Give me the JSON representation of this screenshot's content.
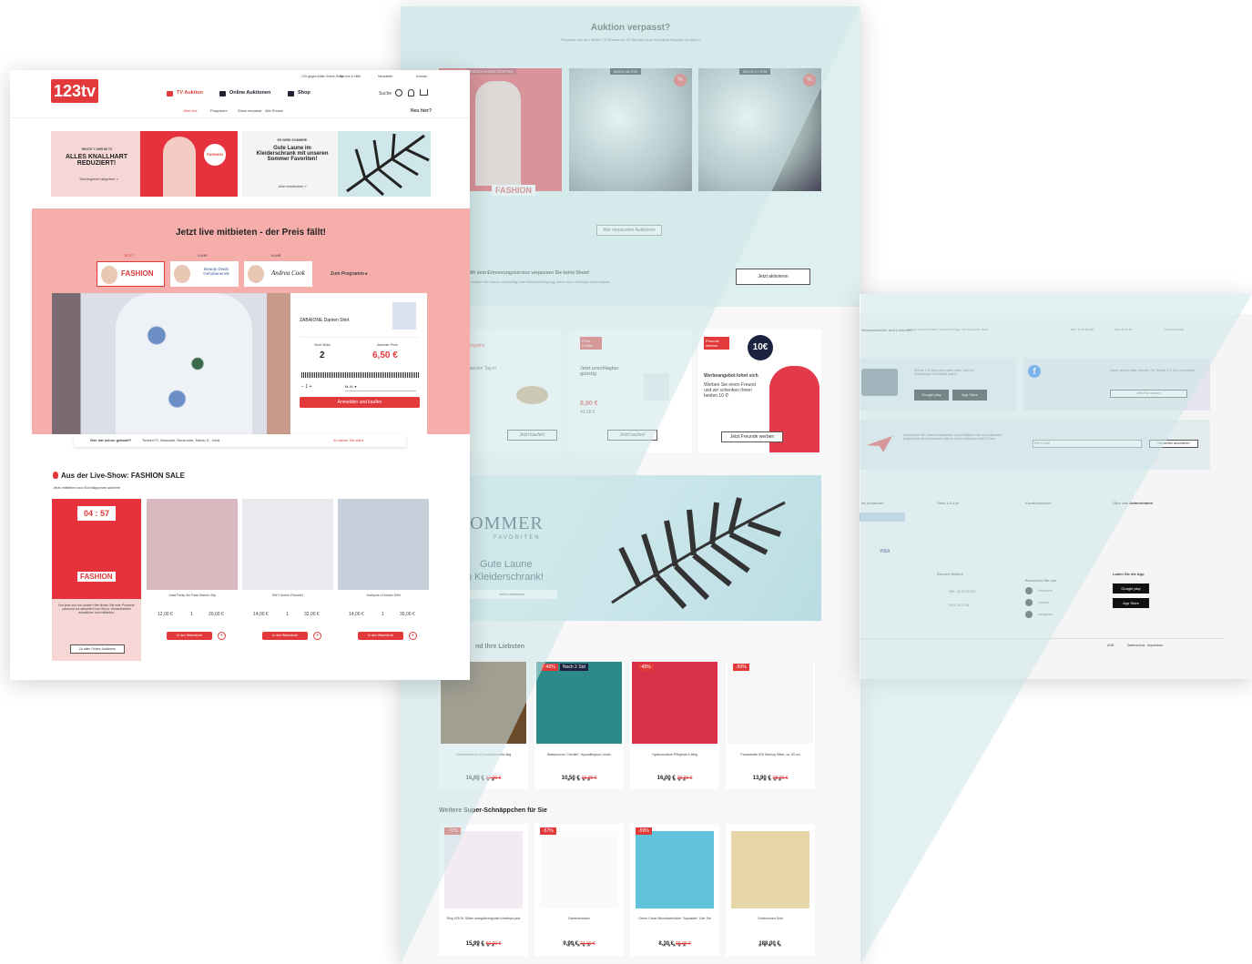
{
  "middle": {
    "auction_title": "Auktion verpasst?",
    "auction_sub": "Produkte aus den letzten TV-Shows nur 24 Stunden zum Schnäppchenpreis shoppen!",
    "tag_fresh": "FRISCH EINGETROFFEN",
    "tag_18": "NOCH 18 STD",
    "tag_17": "NOCH 17 STD",
    "fashion": "FASHION",
    "all_missed": "Alle verpassten Auktionen",
    "reminder_title": "Mit dem Erinnerungsservice verpassen Sie keine Show!",
    "reminder_text": "Erhalten Sie immer rechtzeitig eine Benachrichtigung, wenn Ihre Lieblings-Show startet.",
    "activate": "Jetzt aktivieren",
    "card1_badge": "Angebot",
    "card1_text": "ganzen Tag in",
    "card2_badge": "Preis Knüller",
    "card2_title": "Jetzt unschlagbar günstig",
    "card2_price": "8,90 €",
    "card2_old": "41,00 €",
    "card3_badge": "Freunde werben",
    "card3_title": "Werbeangebot lohnt sich",
    "card3_text": "Werben Sie einen Freund und wir schenken Ihnen beiden 10 €!",
    "card3_value": "10€",
    "buy_now": "Jetzt kaufen!",
    "friend_btn": "Jetzt Freunde werben",
    "banner_sommer": "SOMMER",
    "banner_fav": "FAVORITEN",
    "banner_good": "Gute Laune",
    "banner_closet": "n Kleiderschrank!",
    "banner_btn": "Jetzt entdecken",
    "favs_title": "nd Ihre Liebsten",
    "favs": [
      {
        "name": "Schweinebauch in Dunkelbiersoße 6kg",
        "price": "16,90 €",
        "old": "27,00 €",
        "badge": ""
      },
      {
        "name": "Badeponcho 'Chenille', Hypoallergisch, türkis",
        "price": "10,50 €",
        "old": "16,00 €",
        "badge": "-40%"
      },
      {
        "name": "Hyaluronsäure Pflegeset 4-teilig",
        "price": "16,00 €",
        "old": "26,00 €",
        "badge": "-45%"
      },
      {
        "name": "Panzerkette 925 Sterling Silber, ca. 50 cm",
        "price": "13,90 €",
        "old": "28,00 €",
        "badge": "-50%"
      }
    ],
    "fav_badge2": "Noch 2 Std",
    "more_title": "Weitere Super-Schnäppchen für Sie",
    "more": [
      {
        "name": "Ring 925 St. Silber roségoldvergoldet Amethyst pink",
        "price": "15,99 €",
        "old": "50,00 €",
        "badge": "-70%"
      },
      {
        "name": "Damensneaker",
        "price": "9,99 €",
        "old": "24,00 €",
        "badge": "-57%"
      },
      {
        "name": "Clever Clean Mikrofasertücher \"Aquasafe\" 10er Set",
        "price": "8,30 €",
        "old": "15,00 €",
        "badge": "-59%"
      },
      {
        "name": "Goldmünzen Sets",
        "price": "188,00 €",
        "old": "",
        "badge": ""
      }
    ]
  },
  "left": {
    "logo": "123tv",
    "top_links": [
      "123-gegen-Mitte Online-Shop",
      "Service & Hilfe",
      "Newsletter",
      "Kontakt"
    ],
    "nav": [
      "TV Auktion",
      "Online Auktionen",
      "Shop"
    ],
    "search": "Suche",
    "subnav": [
      "Jetzt live",
      "Programm",
      "Show verpasst",
      "Alle Shows"
    ],
    "new_here": "Neu hier?",
    "promo1_kicker": "HEUTE 7 UHR IM TV",
    "promo1_title": "ALLES KNALLHART REDUZIERT!",
    "promo1_link": "Sendegebiet abgeben »",
    "promo2_kicker": "ES WIRD SOMMER!",
    "promo2_title": "Gute Laune im Kleiderschrank mit unseren Sommer Favoriten!",
    "promo2_link": "Jetzt entdecken »",
    "live_title": "Jetzt live mitbieten - der Preis fällt!",
    "show_tabs": [
      "JETZT",
      "9 UHR",
      "9 UHR"
    ],
    "to_program": "Zum Programm ▸",
    "show2": "Beauty Deals Gehobenerotk",
    "product": "ZABAIONE Damen Shirt",
    "stock_label": "Noch Stück",
    "stock": "2",
    "price_label": "Aktueller Preis",
    "price": "6,50 €",
    "qty": "1",
    "bid_btn": "Anmelden und kaufen",
    "bought_label": "Wer hat schon gekauft?",
    "bought_names": "Torsten73, Vassalab, Neukunde, Martin Z., Ufo8",
    "to_show": "Zu dieser Sie will ▸",
    "fs_title": "Aus der Live-Show: FASHION SALE",
    "fs_sub": "Jetzt mitbieten und Schnäppchen sichern!",
    "timer": "04 : 57",
    "fs_text": "Nur jetzt und nur online! Hier finden Sie tolle Produkte passend zur aktuellen Live-Show. Wunschartikel auswählen und mitbieten.",
    "fs_btn": "Zu allen Online-Auktionen",
    "fs_products": [
      {
        "name": "Jukal Panty 3er Pack Damen Slip",
        "p1": "12,00 €",
        "q": "1",
        "p2": "20,00 €"
      },
      {
        "name": "BNY Herren Poloshirt",
        "p1": "14,00 €",
        "q": "1",
        "p2": "32,00 €"
      },
      {
        "name": "Jodhpurs z Damen Shirt",
        "p1": "14,00 €",
        "q": "1",
        "p2": "30,00 €"
      }
    ],
    "fs_buy": "In den Warenkorb"
  },
  "right": {
    "shipping": "Versandkosten und Lieferzeit",
    "shipping_text": "Versand Standard 6,99€, Lieferzeit 3-5 Tage. Alle Preise inkl. MwSt.",
    "phone1": "089 - 54 22 55 000",
    "phone2": "0900 26 74 58",
    "contact": "Kontaktformular",
    "app_text": "Mit der 123-App noch näher dran. Jetzt für Smartphone und Tablet laden!",
    "fb_text": "Dabei sein ist alles: Werden Sie Teil der 1-2-3.tv Community",
    "fb_btn": "Jetzt Fan werden",
    "nl_text": "Abonnieren Sie unseren Newsletter und profitieren Sie von exklusiven Angeboten! Als Dankeschön gibt es einen Gutschein über 5 Euro.",
    "nl_placeholder": "Ihre E-Mail",
    "nl_btn": "Newsletter abonnieren",
    "col1": "ler einkaufen",
    "col2": "Über 1-2-3.tv",
    "col3": "Kundenservice",
    "col4": "Über das Unternehmen",
    "hotline": "Service Hotline",
    "visit": "Besuchen Sie uns",
    "load_app": "Laden Sie die App",
    "social": [
      "Facebook",
      "Youtube",
      "Instagram"
    ],
    "footer_links": [
      "AGB",
      "Datenschutz",
      "Impressum"
    ],
    "google": "Google play",
    "apple": "App Store"
  }
}
